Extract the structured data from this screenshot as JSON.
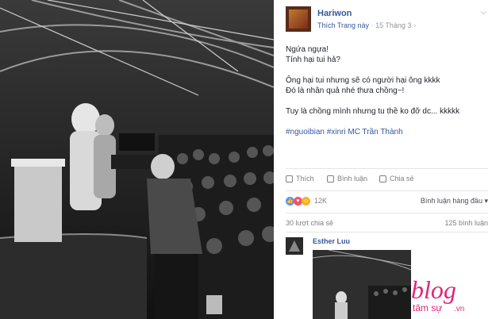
{
  "post": {
    "page_name": "Hariwon",
    "like_page": "Thích Trang này",
    "date": "15 Tháng 3",
    "lines": [
      "Ngứa ngựa!",
      "Tính hại tui hả?",
      "",
      "Ông hại tui nhưng sẽ có người hại ông kkkk",
      "Đó là nhân quả nhé thưa chồng~!",
      "",
      "Tuy là chồng mình nhưng tu thề ko đỡ dc... kkkkk",
      ""
    ],
    "hashtags": "#nguoibian #xinri MC Trần Thành"
  },
  "actions": {
    "like": "Thích",
    "comment": "Bình luận",
    "share": "Chia sẻ"
  },
  "reactions": {
    "count": "12K",
    "sort_label": "Bình luận hàng đầu"
  },
  "counts": {
    "shares": "30 lượt chia sẻ",
    "comments": "125 bình luận"
  },
  "comment": {
    "author": "Esther Luu"
  },
  "watermark": {
    "top": "blog",
    "bottom": "tâm sự",
    "suffix": ".vn"
  },
  "colors": {
    "link": "#365899",
    "text": "#1d2129",
    "muted": "#90949c",
    "like_blue": "#5890ff",
    "love_red": "#f25268",
    "haha_yellow": "#f7b125",
    "brand_pink": "#e0267a"
  },
  "icons": [
    "chevron-down-icon",
    "like-icon",
    "comment-icon",
    "share-icon",
    "like-reaction-icon",
    "love-reaction-icon",
    "haha-reaction-icon"
  ]
}
